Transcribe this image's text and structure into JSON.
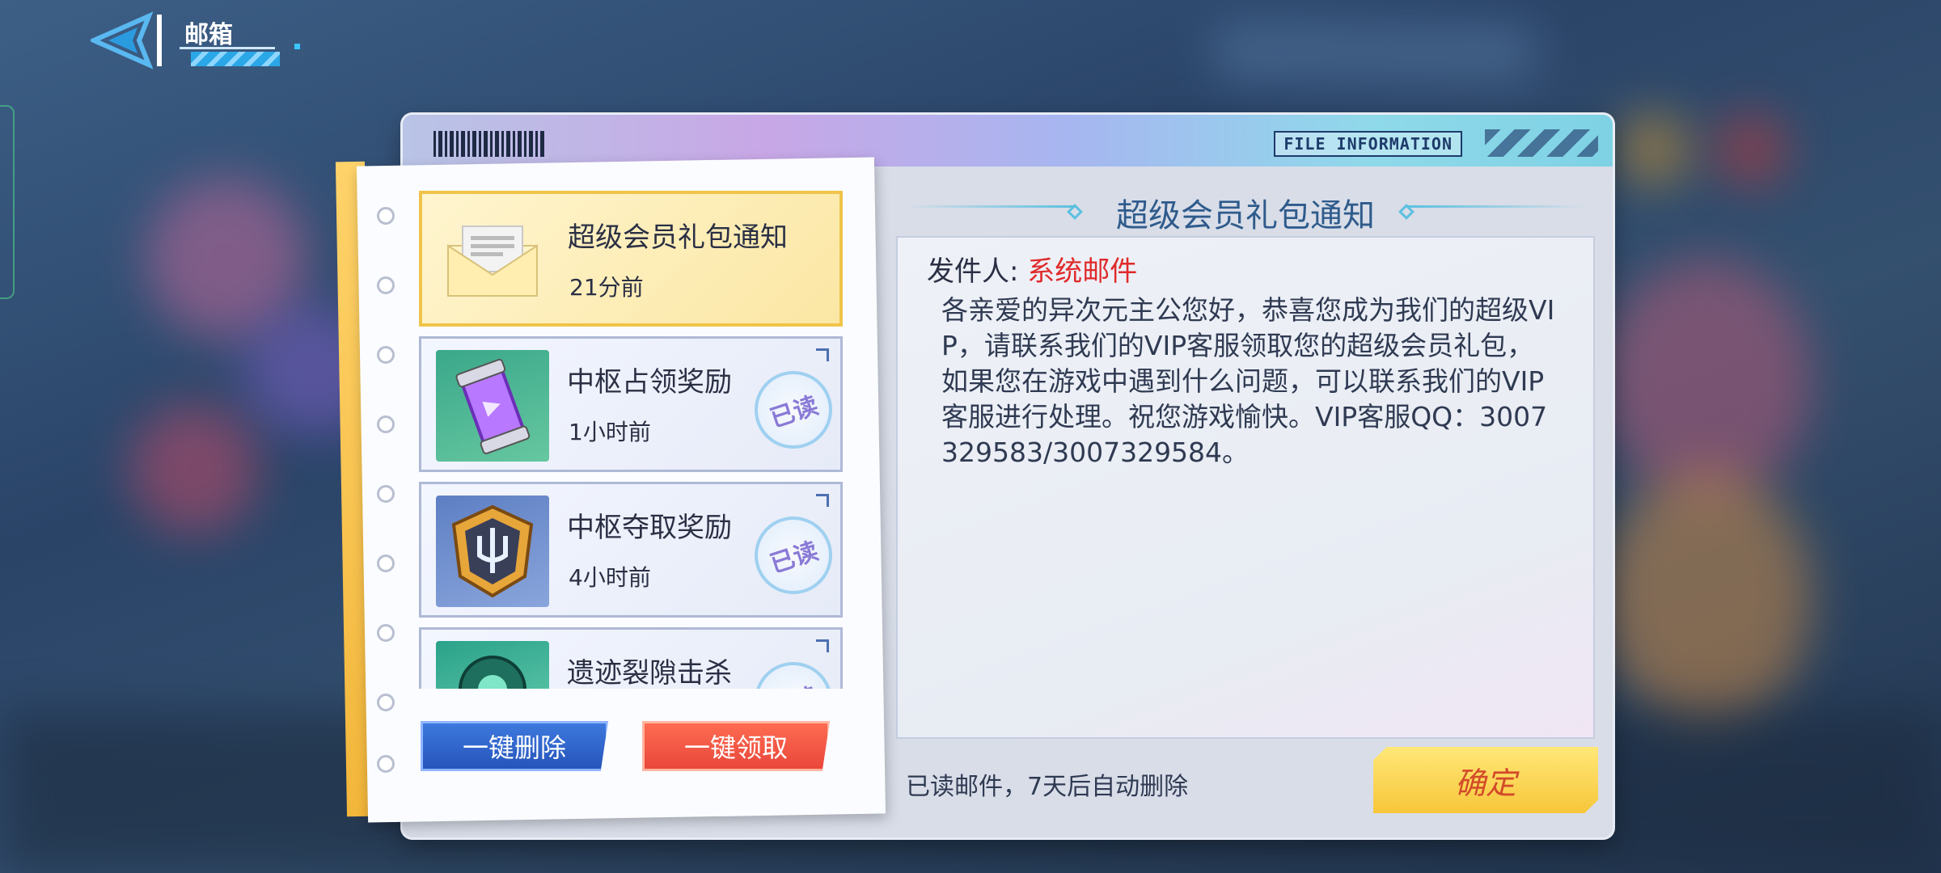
{
  "header": {
    "title": "邮箱"
  },
  "panel": {
    "file_info": "FILE INFORMATION"
  },
  "mail_list": [
    {
      "title": "超级会员礼包通知",
      "time": "21分前",
      "icon": "envelope-icon",
      "read": false,
      "selected": true
    },
    {
      "title": "中枢占领奖励",
      "time": "1小时前",
      "icon": "capsule-icon",
      "read": true,
      "selected": false
    },
    {
      "title": "中枢夺取奖励",
      "time": "4小时前",
      "icon": "trident-shield-icon",
      "read": true,
      "selected": false
    },
    {
      "title": "遗迹裂隙击杀",
      "time": "",
      "icon": "teal-orb-icon",
      "read": true,
      "selected": false
    }
  ],
  "read_stamp": "已读",
  "buttons": {
    "delete_all": "一键删除",
    "claim_all": "一键领取",
    "confirm": "确定"
  },
  "detail": {
    "title": "超级会员礼包通知",
    "sender_label": "发件人:",
    "sender_name": "系统邮件",
    "body": "各亲爱的异次元主公您好，恭喜您成为我们的超级VIP，请联系我们的VIP客服领取您的超级会员礼包，如果您在游戏中遇到什么问题，可以联系我们的VIP客服进行处理。祝您游戏愉快。VIP客服QQ：3007329583/3007329584。",
    "auto_delete_note": "已读邮件，7天后自动删除"
  },
  "colors": {
    "sender_name": "#e02a2a",
    "title_accent": "#2f5b8c",
    "delete_button": "#2452b8",
    "claim_button": "#e8453a",
    "confirm_button": "#f7c63a",
    "selected_item": "#fbe7a4"
  }
}
